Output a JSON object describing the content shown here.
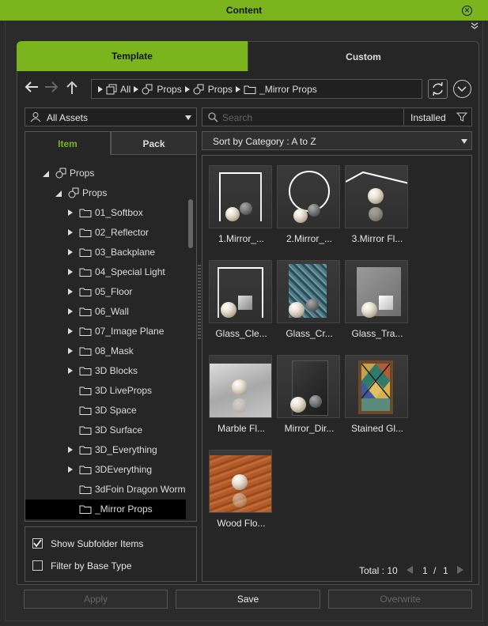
{
  "window": {
    "title": "Content"
  },
  "tabs": {
    "template": "Template",
    "custom": "Custom"
  },
  "breadcrumb": [
    "All",
    "Props",
    "Props",
    "_Mirror Props"
  ],
  "filter": {
    "assets": "All Assets",
    "search_placeholder": "Search",
    "installed": "Installed"
  },
  "sort": {
    "label": "Sort by Category : A to Z"
  },
  "left_tabs": {
    "item": "Item",
    "pack": "Pack"
  },
  "tree": {
    "root": "Props",
    "child": "Props",
    "items": [
      {
        "label": "01_Softbox",
        "expandable": true
      },
      {
        "label": "02_Reflector",
        "expandable": true
      },
      {
        "label": "03_Backplane",
        "expandable": true
      },
      {
        "label": "04_Special Light",
        "expandable": true
      },
      {
        "label": "05_Floor",
        "expandable": true
      },
      {
        "label": "06_Wall",
        "expandable": true
      },
      {
        "label": "07_Image Plane",
        "expandable": true
      },
      {
        "label": "08_Mask",
        "expandable": true
      },
      {
        "label": "3D Blocks",
        "expandable": true
      },
      {
        "label": "3D LiveProps",
        "expandable": false
      },
      {
        "label": "3D Space",
        "expandable": false
      },
      {
        "label": "3D Surface",
        "expandable": false
      },
      {
        "label": "3D_Everything",
        "expandable": true
      },
      {
        "label": "3DEverything",
        "expandable": true
      },
      {
        "label": "3dFoin Dragon Worm",
        "expandable": false
      },
      {
        "label": "_Mirror Props",
        "expandable": false,
        "selected": true
      }
    ]
  },
  "options": {
    "show_subfolder": "Show Subfolder Items",
    "filter_base": "Filter by Base Type",
    "show_subfolder_checked": true,
    "filter_base_checked": false
  },
  "grid": {
    "items": [
      {
        "name": "1.Mirror_..."
      },
      {
        "name": "2.Mirror_..."
      },
      {
        "name": "3.Mirror Fl..."
      },
      {
        "name": "Glass_Cle..."
      },
      {
        "name": "Glass_Cr..."
      },
      {
        "name": "Glass_Tra..."
      },
      {
        "name": "Marble Fl..."
      },
      {
        "name": "Mirror_Dir..."
      },
      {
        "name": "Stained Gl..."
      },
      {
        "name": "Wood Flo..."
      }
    ]
  },
  "pagination": {
    "total_label": "Total : 10",
    "page": "1",
    "sep": "/",
    "pages": "1"
  },
  "buttons": {
    "apply": "Apply",
    "save": "Save",
    "overwrite": "Overwrite"
  },
  "colors": {
    "accent": "#7ab51d",
    "background": "#2b2b2b"
  }
}
